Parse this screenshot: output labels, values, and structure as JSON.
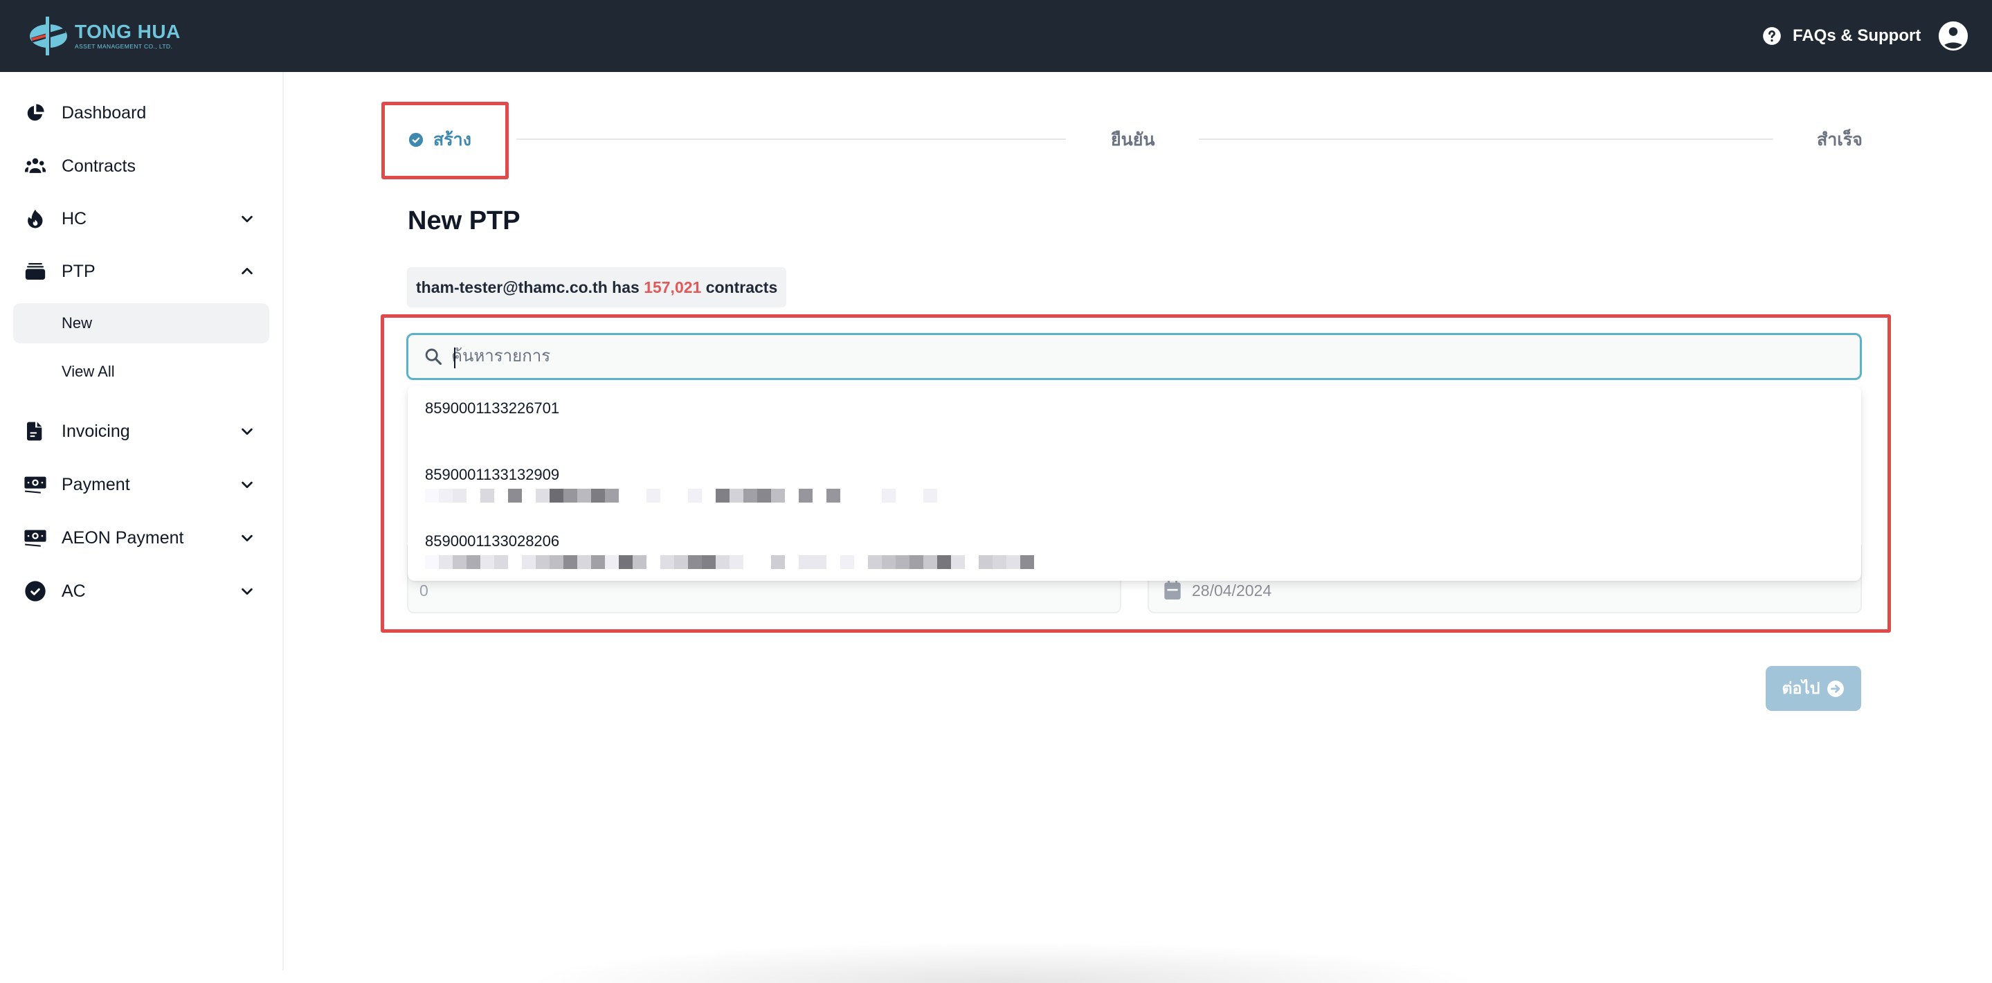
{
  "header": {
    "logo_title": "TONG HUA",
    "logo_subtitle": "ASSET MANAGEMENT CO., LTD.",
    "faq_label": "FAQs & Support",
    "colors": {
      "background": "#1f2833",
      "logo": "#6fc5dc"
    }
  },
  "sidebar": {
    "items": [
      {
        "label": "Dashboard",
        "icon": "pie-chart-icon"
      },
      {
        "label": "Contracts",
        "icon": "users-icon"
      },
      {
        "label": "HC",
        "icon": "fire-icon",
        "expandable": true,
        "expanded": false
      },
      {
        "label": "PTP",
        "icon": "inbox-stack-icon",
        "expandable": true,
        "expanded": true,
        "children": [
          {
            "label": "New",
            "active": true
          },
          {
            "label": "View All",
            "active": false
          }
        ]
      },
      {
        "label": "Invoicing",
        "icon": "document-icon",
        "expandable": true,
        "expanded": false
      },
      {
        "label": "Payment",
        "icon": "banknotes-icon",
        "expandable": true,
        "expanded": false
      },
      {
        "label": "AEON Payment",
        "icon": "banknotes-icon",
        "expandable": true,
        "expanded": false
      },
      {
        "label": "AC",
        "icon": "check-circle-icon",
        "expandable": true,
        "expanded": false
      }
    ]
  },
  "stepper": {
    "steps": [
      {
        "label": "สร้าง",
        "status": "current"
      },
      {
        "label": "ยืนยัน",
        "status": "pending"
      },
      {
        "label": "สำเร็จ",
        "status": "pending"
      }
    ],
    "active_color": "#3f89ae"
  },
  "main": {
    "title": "New PTP",
    "info": {
      "email": "tham-tester@thamc.co.th",
      "has": " has ",
      "count": "157,021",
      "suffix": " contracts",
      "count_color": "#e05a5a"
    },
    "search": {
      "placeholder": "ค้นหารายการ",
      "value": ""
    },
    "dropdown_options": [
      {
        "contract_no": "8590001133226701",
        "detail": ""
      },
      {
        "contract_no": "8590001133132909",
        "detail": "[redacted]"
      },
      {
        "contract_no": "8590001133028206",
        "detail": "[redacted]"
      }
    ],
    "amount_field": {
      "value": "0"
    },
    "date_field": {
      "value": "28/04/2024"
    },
    "next_button": {
      "label": "ต่อไป",
      "disabled": true,
      "color": "#a2c4d9"
    },
    "highlight_color": "#e04a4a"
  }
}
